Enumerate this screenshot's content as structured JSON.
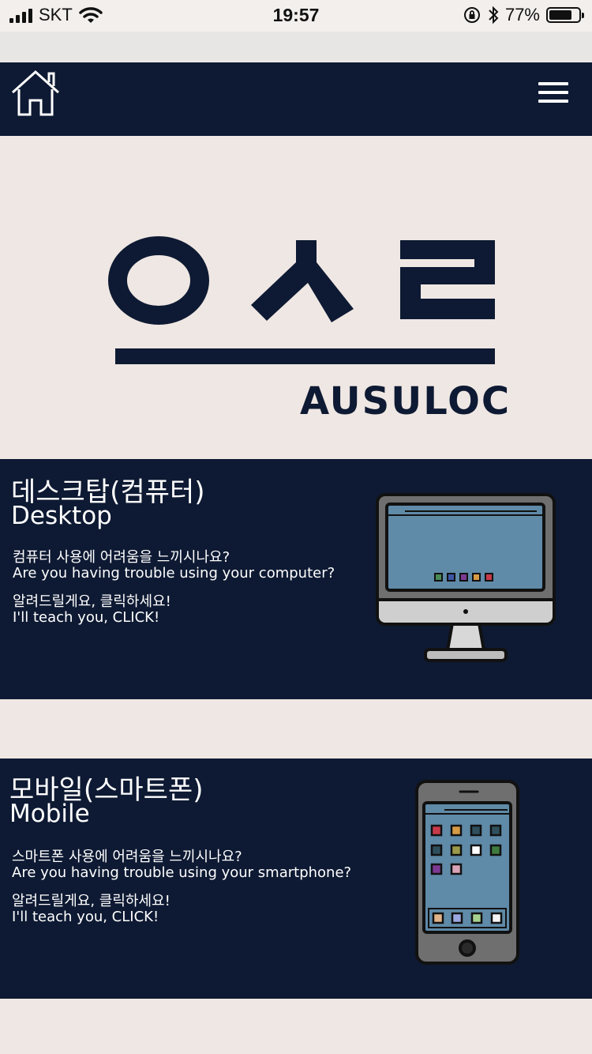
{
  "status_bar": {
    "carrier": "SKT",
    "time": "19:57",
    "battery_percent": "77%",
    "battery_level": 0.77
  },
  "navbar": {
    "home_icon": "home-icon",
    "menu_icon": "hamburger-menu-icon"
  },
  "logo": {
    "wordmark": "AUSULOC",
    "glyph_text": "ㅇㅅㄹ"
  },
  "colors": {
    "navy": "#0e1a33",
    "background": "#efe7e3",
    "screen_blue": "#5f8aa8"
  },
  "sections": [
    {
      "id": "desktop",
      "title_ko": "데스크탑(컴퓨터)",
      "title_en": "Desktop",
      "question_ko": "컴퓨터 사용에 어려움을 느끼시나요?",
      "question_en": "Are you having trouble using your computer?",
      "cta_ko": "알려드릴게요, 클릭하세요!",
      "cta_en": "I'll teach you, CLICK!",
      "icon": "desktop-monitor-icon"
    },
    {
      "id": "mobile",
      "title_ko": "모바일(스마트폰)",
      "title_en": "Mobile",
      "question_ko": "스마트폰 사용에 어려움을 느끼시나요?",
      "question_en": "Are you having trouble using your smartphone?",
      "cta_ko": "알려드릴게요, 클릭하세요!",
      "cta_en": "I'll teach you, CLICK!",
      "icon": "smartphone-icon"
    }
  ]
}
